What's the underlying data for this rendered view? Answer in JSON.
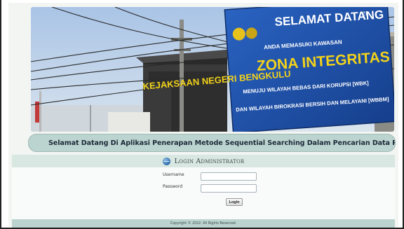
{
  "banner": {
    "sign_welcome": "SELAMAT DATANG",
    "sign_line1": "ANDA MEMASUKI KAWASAN",
    "sign_title": "ZONA INTEGRITAS",
    "sign_line2": "MENUJU WILAYAH BEBAS DARI KORUPSI [WBK]",
    "sign_line3": "DAN WILAYAH BIROKRASI BERSIH DAN MELAYANI [WBBM]",
    "building_text": "KEJAKSAAN NEGERI BENGKULU"
  },
  "marquee": {
    "text": "Selamat Datang Di Aplikasi Penerapan Metode Sequential Searching Dalam Pencarian Data Perkara Pada Kantor Kejaksaan Negeri E"
  },
  "login": {
    "title": "Login Administrator",
    "username_label": "Username",
    "password_label": "Password",
    "username_value": "",
    "password_value": "",
    "submit_label": "Login"
  },
  "footer": {
    "copyright": "Copyright © 2022. All Rights Reserved."
  },
  "colors": {
    "accent": "#bcd4cf",
    "sign_blue": "#1f4fa8",
    "sign_yellow": "#f2d21a"
  }
}
